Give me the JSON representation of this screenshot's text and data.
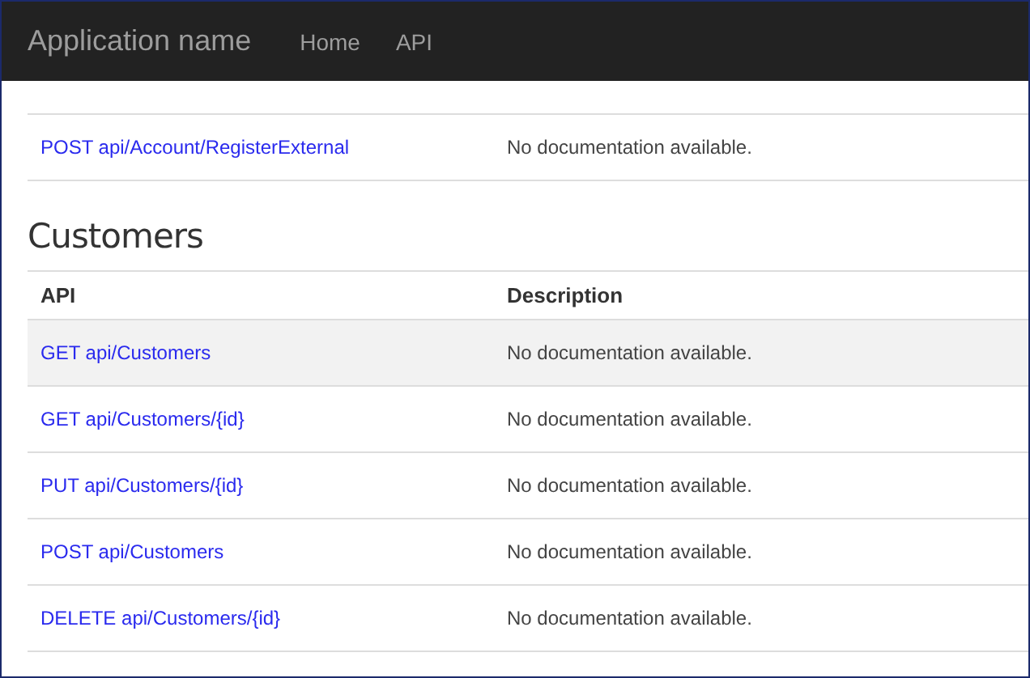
{
  "navbar": {
    "brand": "Application name",
    "links": [
      "Home",
      "API"
    ]
  },
  "previous_table": {
    "rows": [
      {
        "api": "POST api/Account/RegisterExternal",
        "description": "No documentation available.",
        "hovered": false
      }
    ]
  },
  "customers": {
    "title": "Customers",
    "columns": [
      "API",
      "Description"
    ],
    "rows": [
      {
        "api": "GET api/Customers",
        "description": "No documentation available.",
        "hovered": true
      },
      {
        "api": "GET api/Customers/{id}",
        "description": "No documentation available.",
        "hovered": false
      },
      {
        "api": "PUT api/Customers/{id}",
        "description": "No documentation available.",
        "hovered": false
      },
      {
        "api": "POST api/Customers",
        "description": "No documentation available.",
        "hovered": false
      },
      {
        "api": "DELETE api/Customers/{id}",
        "description": "No documentation available.",
        "hovered": false
      }
    ]
  }
}
